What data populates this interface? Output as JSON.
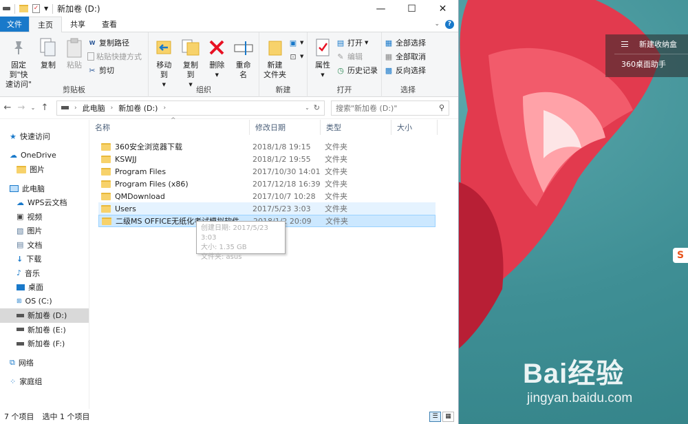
{
  "window": {
    "title": "新加卷 (D:)",
    "tabs": [
      "文件",
      "主页",
      "共享",
      "查看"
    ],
    "controls": {
      "minimize": "—",
      "maximize": "☐",
      "close": "✕"
    }
  },
  "ribbon": {
    "clipboard": {
      "pin": "固定到\"快\n速访问\"",
      "copy": "复制",
      "paste": "粘贴",
      "copy_path": "复制路径",
      "paste_shortcut": "粘贴快捷方式",
      "cut": "剪切",
      "label": "剪贴板"
    },
    "organize": {
      "move_to": "移动到",
      "copy_to": "复制到",
      "delete": "删除",
      "rename": "重命名",
      "label": "组织"
    },
    "new": {
      "new_folder": "新建\n文件夹",
      "label": "新建"
    },
    "open": {
      "properties": "属性",
      "open": "打开",
      "edit": "编辑",
      "history": "历史记录",
      "label": "打开"
    },
    "select": {
      "select_all": "全部选择",
      "select_none": "全部取消",
      "invert": "反向选择",
      "label": "选择"
    }
  },
  "address": {
    "path": [
      "此电脑",
      "新加卷 (D:)"
    ],
    "search_placeholder": "搜索\"新加卷 (D:)\""
  },
  "nav": {
    "items": [
      {
        "label": "快速访问",
        "icon": "star-icon"
      },
      {
        "label": "OneDrive",
        "icon": "cloud-icon"
      },
      {
        "label": "图片",
        "icon": "folder-icon"
      },
      {
        "label": "此电脑",
        "icon": "computer-icon"
      },
      {
        "label": "WPS云文档",
        "icon": "cloud-icon"
      },
      {
        "label": "视频",
        "icon": "video-icon"
      },
      {
        "label": "图片",
        "icon": "picture-icon"
      },
      {
        "label": "文档",
        "icon": "document-icon"
      },
      {
        "label": "下载",
        "icon": "download-icon"
      },
      {
        "label": "音乐",
        "icon": "music-icon"
      },
      {
        "label": "桌面",
        "icon": "desktop-icon"
      },
      {
        "label": "OS (C:)",
        "icon": "drive-icon"
      },
      {
        "label": "新加卷 (D:)",
        "icon": "drive-icon"
      },
      {
        "label": "新加卷 (E:)",
        "icon": "drive-icon"
      },
      {
        "label": "新加卷 (F:)",
        "icon": "drive-icon"
      },
      {
        "label": "网络",
        "icon": "network-icon"
      },
      {
        "label": "家庭组",
        "icon": "homegroup-icon"
      }
    ]
  },
  "columns": [
    "名称",
    "修改日期",
    "类型",
    "大小"
  ],
  "files": [
    {
      "name": "360安全浏览器下载",
      "date": "2018/1/8 19:15",
      "type": "文件夹"
    },
    {
      "name": "KSWJJ",
      "date": "2018/1/2 19:55",
      "type": "文件夹"
    },
    {
      "name": "Program Files",
      "date": "2017/10/30 14:01",
      "type": "文件夹"
    },
    {
      "name": "Program Files (x86)",
      "date": "2017/12/18 16:39",
      "type": "文件夹"
    },
    {
      "name": "QMDownload",
      "date": "2017/10/7 10:28",
      "type": "文件夹"
    },
    {
      "name": "Users",
      "date": "2017/5/23 3:03",
      "type": "文件夹"
    },
    {
      "name": "二级MS OFFICE无纸化考试模拟软件",
      "date": "2018/1/2 20:09",
      "type": "文件夹"
    }
  ],
  "tooltip": {
    "line1": "创建日期: 2017/5/23 3:03",
    "line2": "大小: 1.35 GB",
    "line3": "文件夹: asus"
  },
  "status": {
    "count": "7 个项目",
    "selected": "选中 1 个项目"
  },
  "desktop": {
    "panel": [
      "新建收纳盒",
      "360桌面助手"
    ],
    "watermark": "Bai经验",
    "watermark_url": "jingyan.baidu.com"
  },
  "colors": {
    "accent": "#1979ca",
    "selection": "#cce8ff",
    "hover": "#e5f3ff"
  }
}
